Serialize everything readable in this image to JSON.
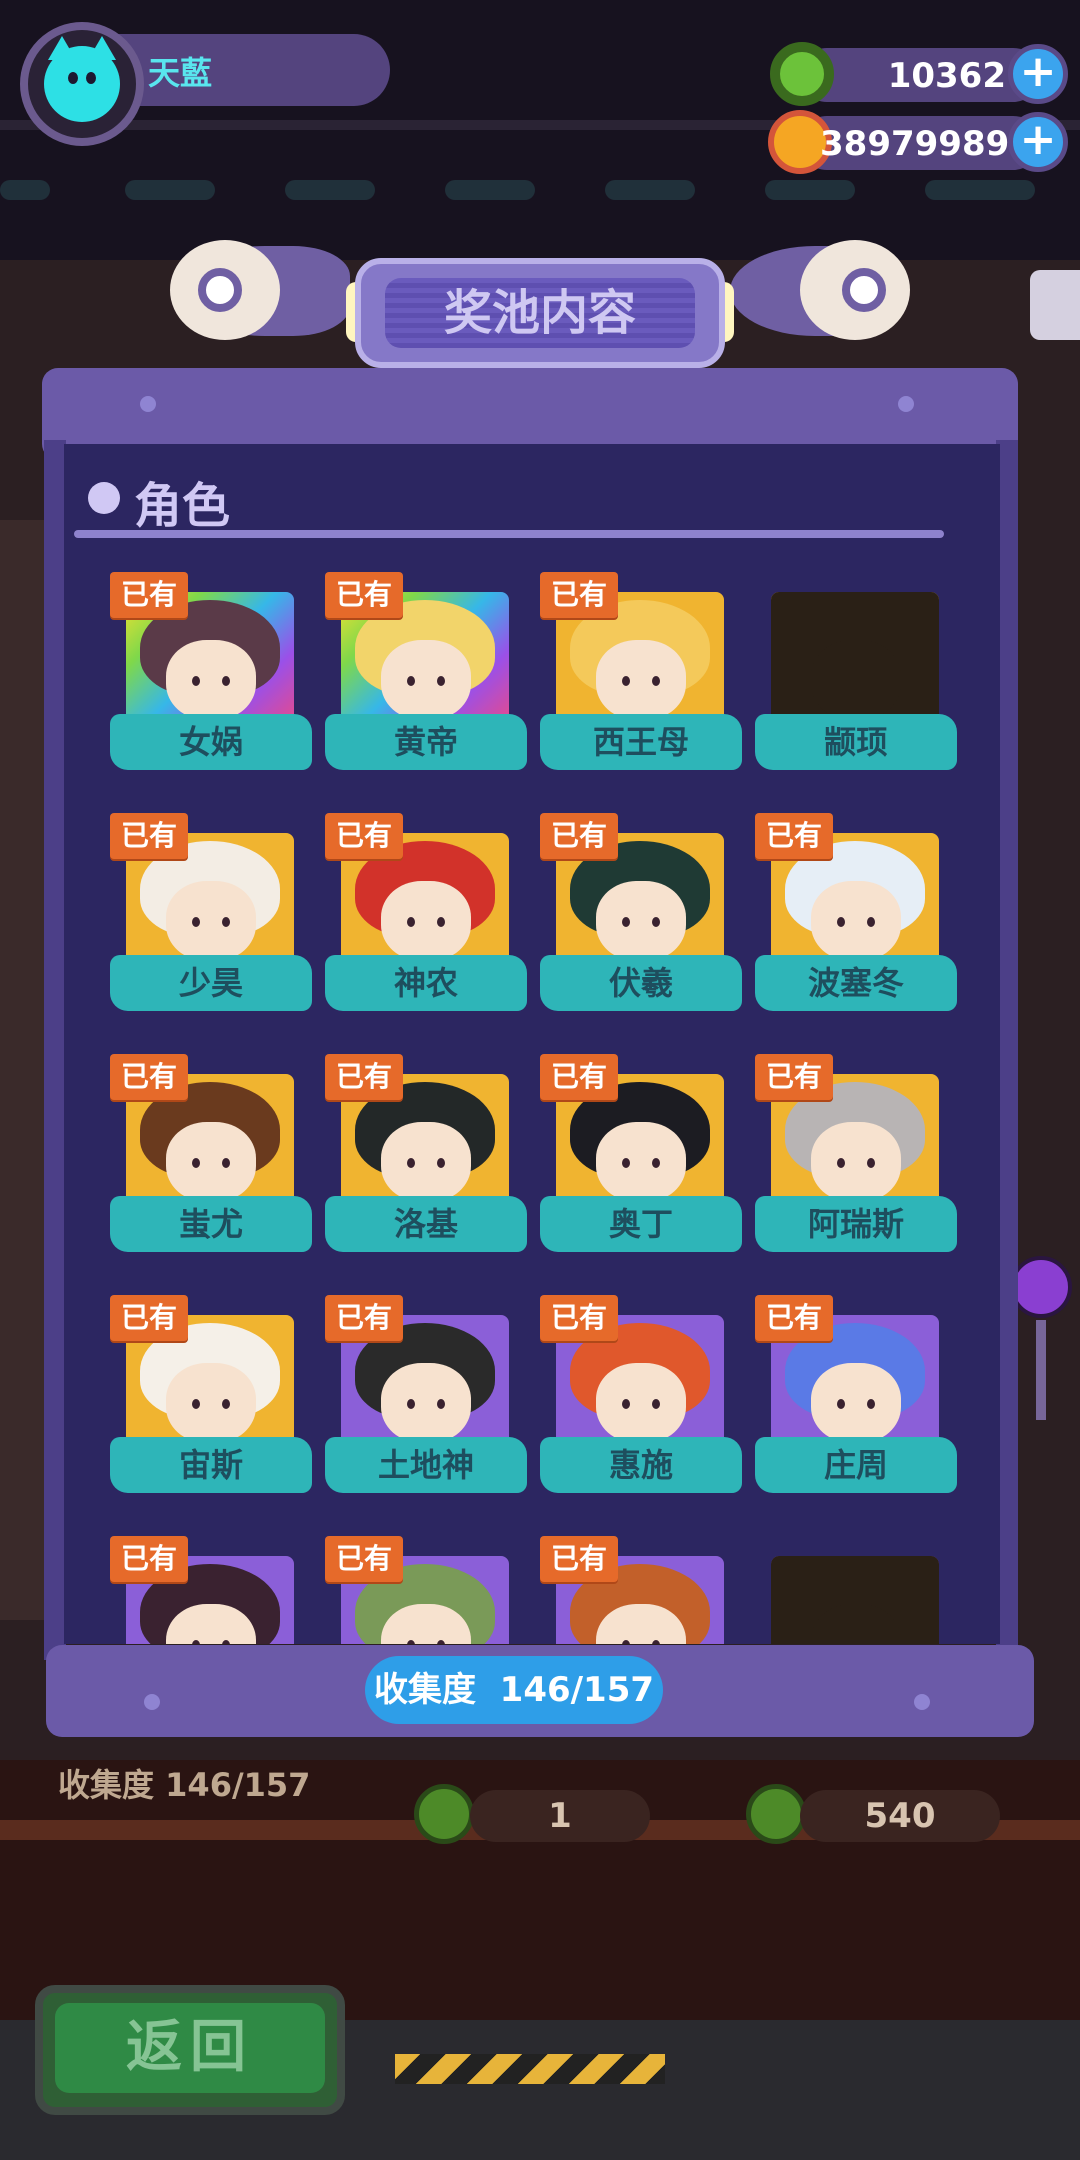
{
  "user": {
    "name": "天藍"
  },
  "currency": [
    {
      "icon": "green-donut-coin-icon",
      "value": "10362"
    },
    {
      "icon": "gold-planet-coin-icon",
      "value": "38979989"
    }
  ],
  "panel": {
    "title": "奖池内容",
    "section_title": "角色",
    "progress_label": "收集度",
    "progress_value": "146/157"
  },
  "owned_label": "已有",
  "characters": [
    {
      "name": "女娲",
      "owned": true,
      "frame": "rainbow",
      "hair": "#5a3a48"
    },
    {
      "name": "黄帝",
      "owned": true,
      "frame": "rainbow",
      "hair": "#f2d46a"
    },
    {
      "name": "西王母",
      "owned": true,
      "frame": "gold",
      "hair": "#f4c95a"
    },
    {
      "name": "颛顼",
      "owned": false,
      "frame": "gold",
      "hair": "#2a2016"
    },
    {
      "name": "少昊",
      "owned": true,
      "frame": "gold",
      "hair": "#f3ede4"
    },
    {
      "name": "神农",
      "owned": true,
      "frame": "gold",
      "hair": "#d2322a"
    },
    {
      "name": "伏羲",
      "owned": true,
      "frame": "gold",
      "hair": "#1f3a34"
    },
    {
      "name": "波塞冬",
      "owned": true,
      "frame": "gold",
      "hair": "#e6eef6"
    },
    {
      "name": "蚩尤",
      "owned": true,
      "frame": "gold",
      "hair": "#6a3a1e"
    },
    {
      "name": "洛基",
      "owned": true,
      "frame": "gold",
      "hair": "#232828"
    },
    {
      "name": "奥丁",
      "owned": true,
      "frame": "gold",
      "hair": "#1c1c22"
    },
    {
      "name": "阿瑞斯",
      "owned": true,
      "frame": "gold",
      "hair": "#b8b4b4"
    },
    {
      "name": "宙斯",
      "owned": true,
      "frame": "gold",
      "hair": "#f5f0e8"
    },
    {
      "name": "土地神",
      "owned": true,
      "frame": "purple",
      "hair": "#2a2a2a"
    },
    {
      "name": "惠施",
      "owned": true,
      "frame": "purple",
      "hair": "#e0582c"
    },
    {
      "name": "庄周",
      "owned": true,
      "frame": "purple",
      "hair": "#5a7ae6"
    },
    {
      "name": "",
      "owned": true,
      "frame": "purple",
      "hair": "#3a2230"
    },
    {
      "name": "",
      "owned": true,
      "frame": "purple",
      "hair": "#7a9a58"
    },
    {
      "name": "",
      "owned": true,
      "frame": "purple",
      "hair": "#c2602a"
    },
    {
      "name": "",
      "owned": false,
      "frame": "purple",
      "hair": "#2a2016"
    }
  ],
  "background": {
    "collect_label": "收集度",
    "collect_value": "146/157",
    "cost_single": "1",
    "cost_multi": "540",
    "back_button": "返回"
  },
  "colors": {
    "accent_blue": "#2e9ee8",
    "label_teal": "#2eb5b8",
    "owned_orange": "#e66a2a",
    "panel_purple": "#2c2661"
  }
}
